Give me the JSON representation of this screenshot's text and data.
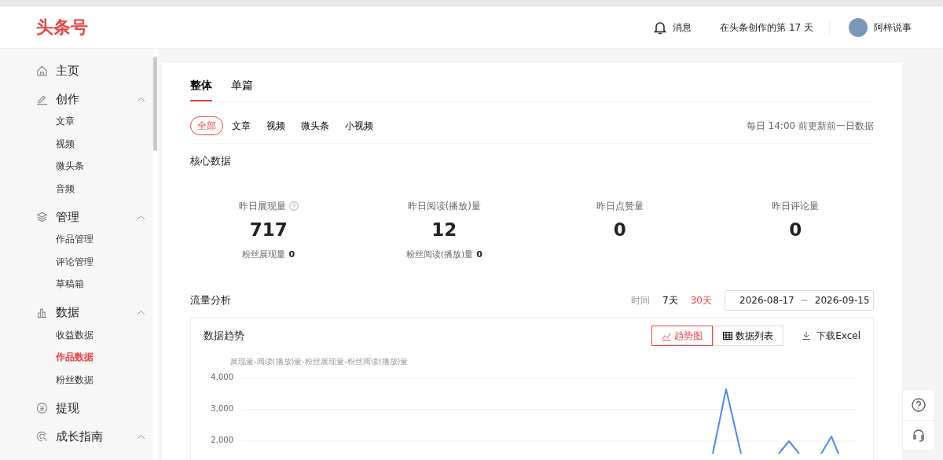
{
  "header": {
    "logo": "头条号",
    "messages": "消息",
    "days": "在头条创作的第 17 天",
    "username": "阿梓说事"
  },
  "sidebar": {
    "items": [
      {
        "label": "主页"
      },
      {
        "label": "创作",
        "expanded": true,
        "children": [
          {
            "label": "文章",
            "selected": false
          },
          {
            "label": "视频",
            "selected": false
          },
          {
            "label": "微头条",
            "selected": false
          },
          {
            "label": "音频",
            "selected": false
          }
        ]
      },
      {
        "label": "管理",
        "expanded": true,
        "children": [
          {
            "label": "作品管理",
            "selected": false
          },
          {
            "label": "评论管理",
            "selected": false
          },
          {
            "label": "草稿箱",
            "selected": false
          }
        ]
      },
      {
        "label": "数据",
        "expanded": true,
        "children": [
          {
            "label": "收益数据",
            "selected": false
          },
          {
            "label": "作品数据",
            "selected": true
          },
          {
            "label": "粉丝数据",
            "selected": false
          }
        ]
      },
      {
        "label": "提现"
      },
      {
        "label": "成长指南",
        "expanded": true
      }
    ]
  },
  "tabs": [
    {
      "label": "整体",
      "selected": true
    },
    {
      "label": "单篇",
      "selected": false
    }
  ],
  "filters": [
    {
      "label": "全部",
      "selected": true
    },
    {
      "label": "文章",
      "selected": false
    },
    {
      "label": "视频",
      "selected": false
    },
    {
      "label": "微头条",
      "selected": false
    },
    {
      "label": "小视频",
      "selected": false
    }
  ],
  "update_note": "每日 14:00 前更新前一日数据",
  "core": {
    "title": "核心数据",
    "stats": [
      {
        "label": "昨日展现量",
        "has_help": true,
        "value": "717",
        "sub_label": "粉丝展现量",
        "sub_value": "0"
      },
      {
        "label": "昨日阅读(播放)量",
        "value": "12",
        "sub_label": "粉丝阅读(播放)量",
        "sub_value": "0"
      },
      {
        "label": "昨日点赞量",
        "value": "0"
      },
      {
        "label": "昨日评论量",
        "value": "0"
      }
    ]
  },
  "traffic": {
    "title": "流量分析",
    "time_label": "时间",
    "ranges": [
      {
        "label": "7天",
        "selected": false
      },
      {
        "label": "30天",
        "selected": true
      }
    ],
    "date_from": "2026-08-17",
    "date_sep": "~",
    "date_to": "2026-09-15",
    "panel": {
      "title": "数据趋势",
      "views": [
        {
          "label": "趋势图",
          "selected": true
        },
        {
          "label": "数据列表",
          "selected": false
        }
      ],
      "download": "下载Excel",
      "legend": "展现量-阅读(播放)量-粉丝展现量-粉丝阅读(播放)量",
      "y_axis_labels": [
        "4,000",
        "3,000",
        "2,000"
      ]
    }
  }
}
